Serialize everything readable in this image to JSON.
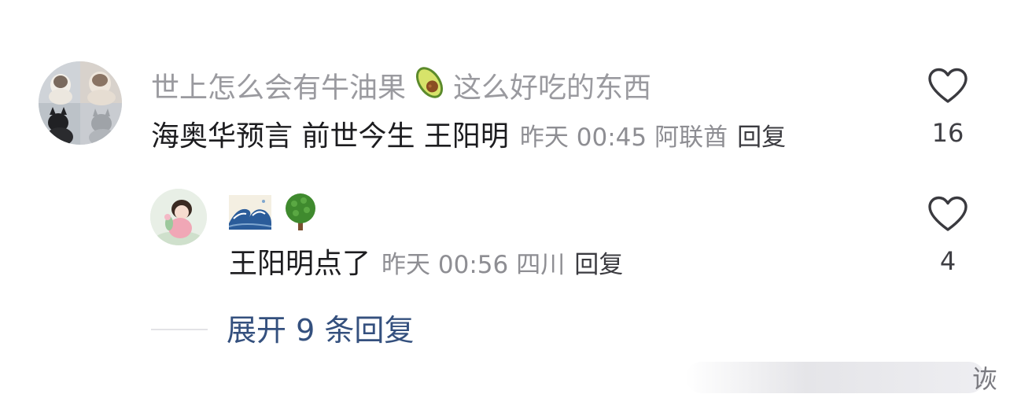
{
  "comment1": {
    "username_prefix": "世上怎么会有牛油果",
    "username_suffix": "这么好吃的东西",
    "username_emoji": "avocado-icon",
    "content": "海奥华预言 前世今生 王阳明",
    "time": "昨天 00:45",
    "location": "阿联酋",
    "reply_label": "回复",
    "likes": "16"
  },
  "comment2": {
    "username_emoji_1": "wave-icon",
    "username_emoji_2": "tree-icon",
    "content": "王阳明点了",
    "time": "昨天 00:56",
    "location": "四川",
    "reply_label": "回复",
    "likes": "4"
  },
  "expand_replies": "展开 9 条回复",
  "watermark": "诙",
  "colors": {
    "username": "#9a9a9f",
    "content": "#1c1c1f",
    "meta": "#8e8e93",
    "expand_link": "#34507e"
  }
}
